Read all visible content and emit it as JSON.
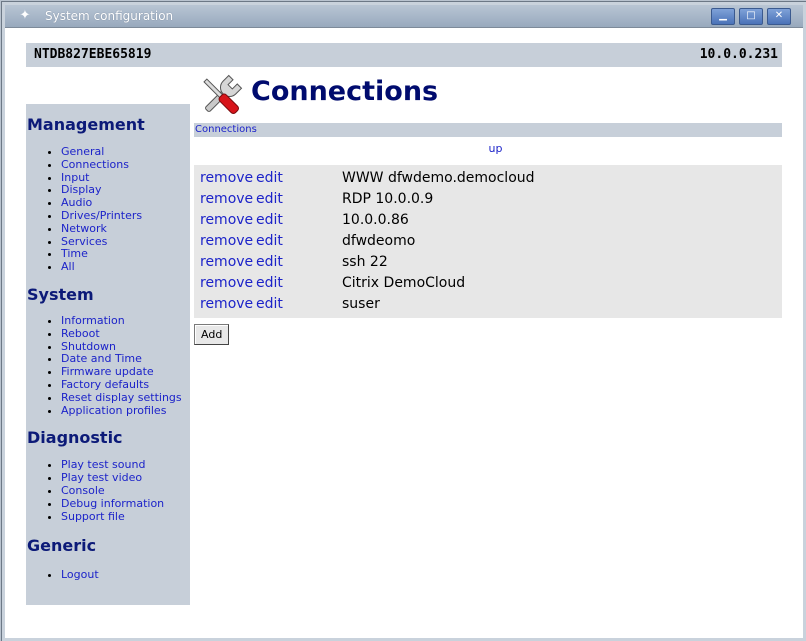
{
  "window": {
    "title": "System configuration",
    "buttons": {
      "minimize": "▁",
      "maximize": "□",
      "close": "✕"
    }
  },
  "header": {
    "hostname": "NTDB827EBE65819",
    "ip": "10.0.0.231"
  },
  "page": {
    "title": "Connections",
    "breadcrumb": "Connections",
    "up_label": "up"
  },
  "sidebar": {
    "sections": [
      {
        "title": "Management",
        "items": [
          "General",
          "Connections",
          "Input",
          "Display",
          "Audio",
          "Drives/Printers",
          "Network",
          "Services",
          "Time",
          "All"
        ]
      },
      {
        "title": "System",
        "items": [
          "Information",
          "Reboot",
          "Shutdown",
          "Date and Time",
          "Firmware update",
          "Factory defaults",
          "Reset display settings",
          "Application profiles"
        ]
      },
      {
        "title": "Diagnostic",
        "items": [
          "Play test sound",
          "Play test video",
          "Console",
          "Debug information",
          "Support file"
        ]
      },
      {
        "title": "Generic",
        "items": [
          "Logout"
        ]
      }
    ]
  },
  "connections": {
    "remove_label": "remove",
    "edit_label": "edit",
    "items": [
      "WWW dfwdemo.democloud",
      "RDP 10.0.0.9",
      "10.0.0.86",
      "dfwdeomo",
      "ssh 22",
      "Citrix DemoCloud",
      "suser"
    ]
  },
  "actions": {
    "add_label": "Add"
  },
  "colors": {
    "heading": "#000b6e",
    "link": "#1c23c9",
    "panel": "#c7cfd9",
    "table_bg": "#e7e7e7"
  }
}
